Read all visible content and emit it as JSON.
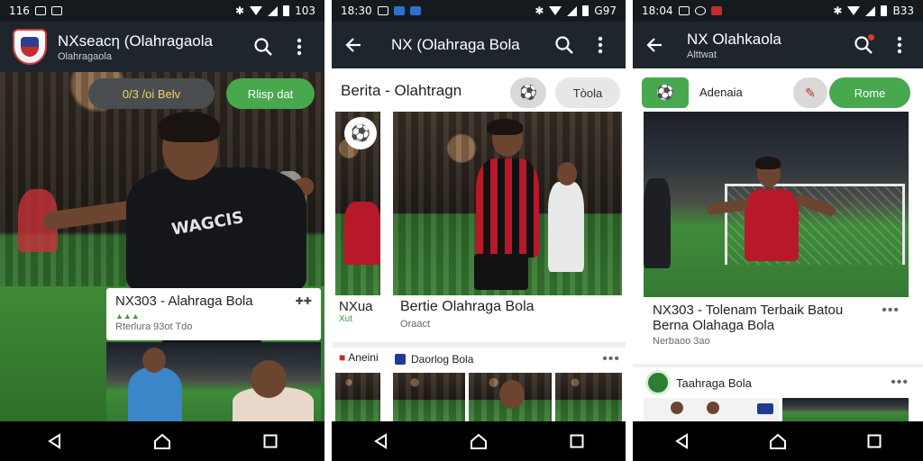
{
  "status_bars": [
    {
      "time": "116",
      "right": "103"
    },
    {
      "time": "18:30",
      "right": "G97"
    },
    {
      "time": "18:04",
      "right": "B33"
    }
  ],
  "screen1": {
    "app_title": "NXѕеасη (Olahragaola",
    "app_subtitle": "Olahragaola",
    "chip_left": "0/3 /oi Belv",
    "chip_right": "Rlisp dat",
    "card_title": "NX303 - Alahraga Bola",
    "card_sub": "Rterlura 93ot Tdo",
    "jersey_text": "WAGCIS"
  },
  "screen2": {
    "app_title": "NX (Olahraga Bola",
    "section_title": "Berita - Olahtragn",
    "chip_right": "Tòola",
    "card_title": "Bertie Olahraga Bola",
    "card_sub": "Oraact",
    "side_card_title": "NXua",
    "side_card_sub": "Xut",
    "row_label_left": "Aneini",
    "row_label": "Daorlog Bola",
    "row_dots": "•••"
  },
  "screen3": {
    "app_title": "NX Olahkaola",
    "app_subtitle": "Alttwat",
    "chip_mid": "Adenaia",
    "chip_right": "Rome",
    "card_title_1": "NX303 - Tolenam Terbaik Batou",
    "card_title_2": "Berna Olahaga Bola",
    "card_sub": "Nerbaoo 3ao",
    "card_dots": "•••",
    "row_label": "Taahraga Bola",
    "row_dots": "•••"
  },
  "colors": {
    "appbar": "#1e252c",
    "accent_green": "#48a84e",
    "chip_gray": "#e7e7e7",
    "jersey_red": "#b8182a"
  }
}
